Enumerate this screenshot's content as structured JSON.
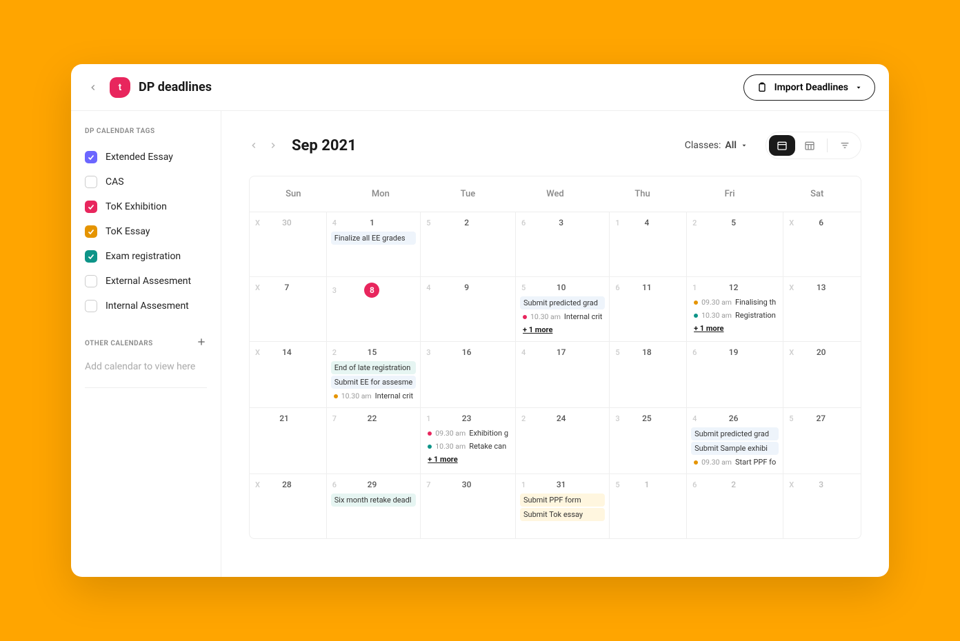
{
  "header": {
    "logo_letter": "t",
    "title": "DP deadlines",
    "import_label": "Import Deadlines"
  },
  "sidebar": {
    "tags_heading": "DP CALENDAR TAGS",
    "tags": [
      {
        "label": "Extended Essay",
        "checked": true,
        "color": "#6B66FF"
      },
      {
        "label": "CAS",
        "checked": false,
        "color": ""
      },
      {
        "label": "ToK Exhibition",
        "checked": true,
        "color": "#E8265D"
      },
      {
        "label": "ToK Essay",
        "checked": true,
        "color": "#E59400"
      },
      {
        "label": "Exam registration",
        "checked": true,
        "color": "#0D9488"
      },
      {
        "label": "External Assesment",
        "checked": false,
        "color": ""
      },
      {
        "label": "Internal Assesment",
        "checked": false,
        "color": ""
      }
    ],
    "other_heading": "OTHER CALENDARS",
    "other_placeholder": "Add calendar to view here"
  },
  "calendar": {
    "month": "Sep 2021",
    "classes_label": "Classes:",
    "classes_value": "All",
    "weekdays": [
      "Sun",
      "Mon",
      "Tue",
      "Wed",
      "Thu",
      "Fri",
      "Sat"
    ],
    "cells": [
      {
        "count": "X",
        "date": "30",
        "out": true
      },
      {
        "count": "4",
        "date": "1",
        "events": [
          {
            "type": "block",
            "variant": "blue",
            "label": "Finalize all EE grades"
          }
        ]
      },
      {
        "count": "5",
        "date": "2"
      },
      {
        "count": "6",
        "date": "3"
      },
      {
        "count": "1",
        "date": "4"
      },
      {
        "count": "2",
        "date": "5"
      },
      {
        "count": "X",
        "date": "6"
      },
      {
        "count": "X",
        "date": "7"
      },
      {
        "count": "3",
        "date": "8",
        "today": true
      },
      {
        "count": "4",
        "date": "9"
      },
      {
        "count": "5",
        "date": "10",
        "events": [
          {
            "type": "block",
            "variant": "blue",
            "label": "Submit predicted grad"
          },
          {
            "type": "dot",
            "dot": "#E8265D",
            "time": "10.30 am",
            "label": "Internal crit"
          }
        ],
        "more": "+ 1 more"
      },
      {
        "count": "6",
        "date": "11"
      },
      {
        "count": "1",
        "date": "12",
        "events": [
          {
            "type": "dot",
            "dot": "#E59400",
            "time": "09.30 am",
            "label": "Finalising th"
          },
          {
            "type": "dot",
            "dot": "#0D9488",
            "time": "10.30 am",
            "label": "Registration"
          }
        ],
        "more": "+ 1 more"
      },
      {
        "count": "X",
        "date": "13"
      },
      {
        "count": "X",
        "date": "14"
      },
      {
        "count": "2",
        "date": "15",
        "events": [
          {
            "type": "block",
            "variant": "teal",
            "label": "End of late registration"
          },
          {
            "type": "block",
            "variant": "blue",
            "label": "Submit EE for assesme"
          },
          {
            "type": "dot",
            "dot": "#E59400",
            "time": "10.30 am",
            "label": "Internal crit"
          }
        ]
      },
      {
        "count": "3",
        "date": "16"
      },
      {
        "count": "4",
        "date": "17"
      },
      {
        "count": "5",
        "date": "18"
      },
      {
        "count": "6",
        "date": "19"
      },
      {
        "count": "X",
        "date": "20"
      },
      {
        "count": "",
        "date": "21"
      },
      {
        "count": "7",
        "date": "22"
      },
      {
        "count": "1",
        "date": "23",
        "events": [
          {
            "type": "dot",
            "dot": "#E8265D",
            "time": "09.30 am",
            "label": "Exhibition g"
          },
          {
            "type": "dot",
            "dot": "#0D9488",
            "time": "10.30 am",
            "label": "Retake can"
          }
        ],
        "more": "+ 1 more"
      },
      {
        "count": "2",
        "date": "24"
      },
      {
        "count": "3",
        "date": "25"
      },
      {
        "count": "4",
        "date": "26",
        "events": [
          {
            "type": "block",
            "variant": "blue",
            "label": "Submit predicted grad"
          },
          {
            "type": "block",
            "variant": "blue",
            "label": "Submit Sample exhibi"
          },
          {
            "type": "dot",
            "dot": "#E59400",
            "time": "09.30 am",
            "label": "Start PPF fo"
          }
        ]
      },
      {
        "count": "5",
        "date": "27"
      },
      {
        "count": "X",
        "date": "28"
      },
      {
        "count": "6",
        "date": "29",
        "events": [
          {
            "type": "block",
            "variant": "teal",
            "label": "Six month retake deadl"
          }
        ]
      },
      {
        "count": "7",
        "date": "30"
      },
      {
        "count": "1",
        "date": "31",
        "events": [
          {
            "type": "block",
            "variant": "amber",
            "label": "Submit PPF form"
          },
          {
            "type": "block",
            "variant": "amber",
            "label": "Submit Tok essay"
          }
        ]
      },
      {
        "count": "5",
        "date": "1",
        "out": true
      },
      {
        "count": "6",
        "date": "2",
        "out": true
      },
      {
        "count": "X",
        "date": "3",
        "out": true
      }
    ]
  }
}
